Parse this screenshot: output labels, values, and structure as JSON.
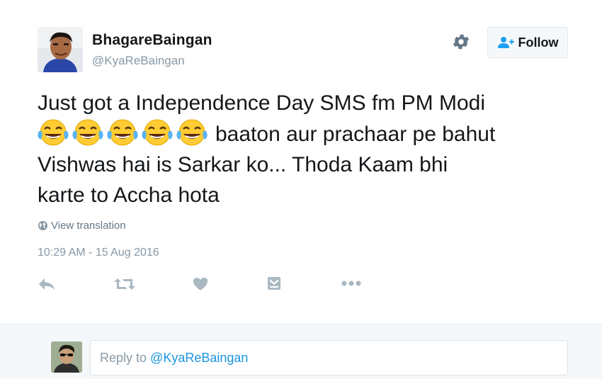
{
  "author": {
    "display_name": "BhagareBaingan",
    "handle": "@KyaReBaingan"
  },
  "header": {
    "follow_label": "Follow",
    "settings_icon": "gear-icon"
  },
  "tweet": {
    "text_line1": "Just got a Independence Day SMS fm PM Modi",
    "emoji": [
      "face-with-tears-of-joy",
      "face-with-tears-of-joy",
      "face-with-tears-of-joy",
      "face-with-tears-of-joy",
      "face-with-tears-of-joy"
    ],
    "text_after_emoji": "baaton aur prachaar pe bahut",
    "text_line3": "Vishwas hai is Sarkar ko... Thoda Kaam bhi",
    "text_line4": "karte to Accha hota",
    "translate_label": "View translation",
    "timestamp": "10:29 AM - 15 Aug 2016"
  },
  "actions": [
    "reply-icon",
    "retweet-icon",
    "like-icon",
    "moment-icon",
    "more-icon"
  ],
  "reply": {
    "prefix": "Reply to",
    "mention": "@KyaReBaingan"
  },
  "colors": {
    "icon_gray": "#aab8c2",
    "link_blue": "#1b95e0",
    "follow_blue": "#1da1f2",
    "emoji_yellow": "#ffcc33"
  }
}
